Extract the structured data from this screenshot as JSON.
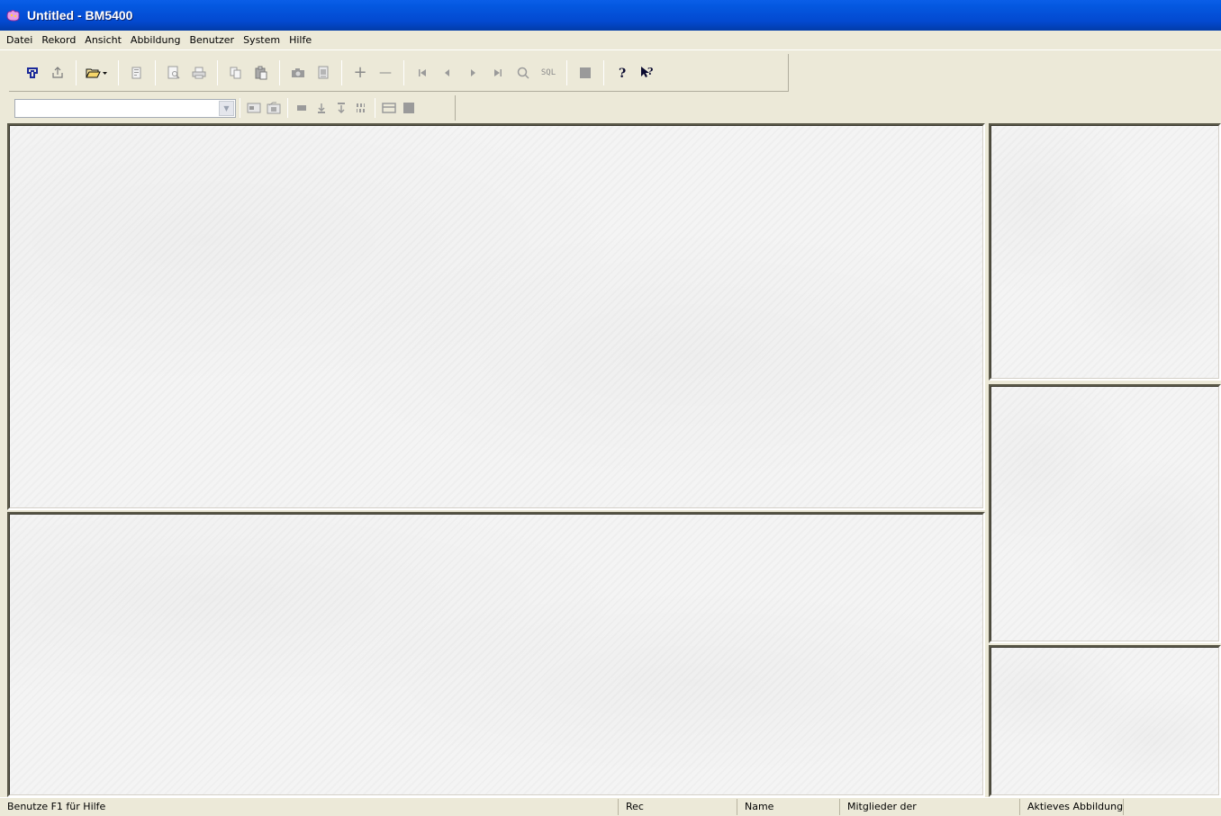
{
  "window": {
    "title": "Untitled - BM5400"
  },
  "menu": {
    "items": [
      "Datei",
      "Rekord",
      "Ansicht",
      "Abbildung",
      "Benutzer",
      "System",
      "Hilfe"
    ]
  },
  "toolbar": {
    "sql_label": "SQL",
    "plus": "+",
    "minus": "—",
    "help": "?",
    "context_help": "?"
  },
  "toolbar2": {
    "combo_value": ""
  },
  "statusbar": {
    "help_text": "Benutze F1 für Hilfe",
    "rec": "Rec",
    "name": "Name",
    "members": "Mitglieder der",
    "active_image": "Aktieves Abbildung"
  }
}
